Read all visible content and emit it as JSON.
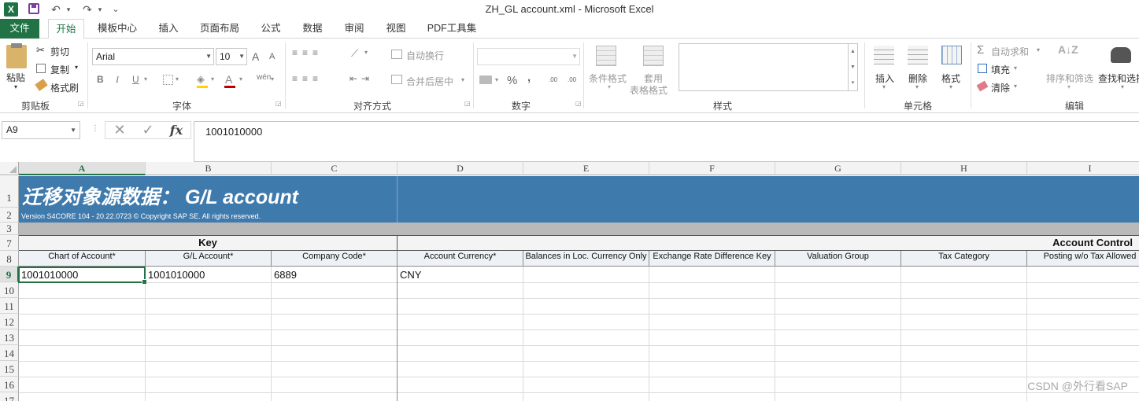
{
  "window": {
    "title": "ZH_GL account.xml - Microsoft Excel"
  },
  "quick_access": {
    "logo": "X",
    "undo": "↶",
    "redo": "↷",
    "dropdown": "⌄"
  },
  "ribbon_tabs": [
    "文件",
    "开始",
    "模板中心",
    "插入",
    "页面布局",
    "公式",
    "数据",
    "审阅",
    "视图",
    "PDF工具集"
  ],
  "ribbon": {
    "clipboard": {
      "paste": "粘贴",
      "cut": "剪切",
      "copy": "复制",
      "format_painter": "格式刷",
      "group": "剪贴板"
    },
    "font": {
      "name": "Arial",
      "size": "10",
      "group": "字体",
      "bold": "B",
      "italic": "I",
      "underline": "U",
      "grow": "A",
      "shrink": "A",
      "color": "A",
      "phonetic": "wén"
    },
    "alignment": {
      "wrap": "自动换行",
      "merge": "合并后居中",
      "group": "对齐方式"
    },
    "number": {
      "group": "数字",
      "percent": "%",
      "comma": ",",
      "inc": ".00",
      "dec": ".00"
    },
    "styles": {
      "conditional": "条件格式",
      "table_line1": "套用",
      "table_line2": "表格格式",
      "group": "样式"
    },
    "cells": {
      "insert": "插入",
      "delete": "删除",
      "format": "格式",
      "group": "单元格"
    },
    "editing": {
      "autosum": "自动求和",
      "fill": "填充",
      "clear": "清除",
      "sort": "排序和筛选",
      "find": "查找和选择",
      "group": "编辑"
    }
  },
  "formula_bar": {
    "name_box": "A9",
    "value": "1001010000",
    "cancel": "✕",
    "enter": "✓",
    "fx": "fx"
  },
  "columns": [
    "A",
    "B",
    "C",
    "D",
    "E",
    "F",
    "G",
    "H",
    "I"
  ],
  "rows": [
    "1",
    "2",
    "3",
    "7",
    "8",
    "9",
    "10",
    "11",
    "12",
    "13",
    "14",
    "15",
    "16",
    "17"
  ],
  "sheet": {
    "banner_title": "迁移对象源数据：   G/L account",
    "banner_subtitle": "Version S4CORE 104  - 20.22.0723 © Copyright SAP SE. All rights reserved.",
    "group_key": "Key",
    "group_control": "Account Control",
    "headers": [
      "Chart of Account*",
      "G/L Account*",
      "Company Code*",
      "Account Currency*",
      "Balances in Loc. Currency Only",
      "Exchange Rate Difference Key",
      "Valuation Group",
      "Tax Category",
      "Posting w/o Tax Allowed"
    ],
    "row9": [
      "1001010000",
      "1001010000",
      "6889",
      "CNY",
      "",
      "",
      "",
      "",
      ""
    ]
  },
  "watermark": "CSDN @外行看SAP"
}
